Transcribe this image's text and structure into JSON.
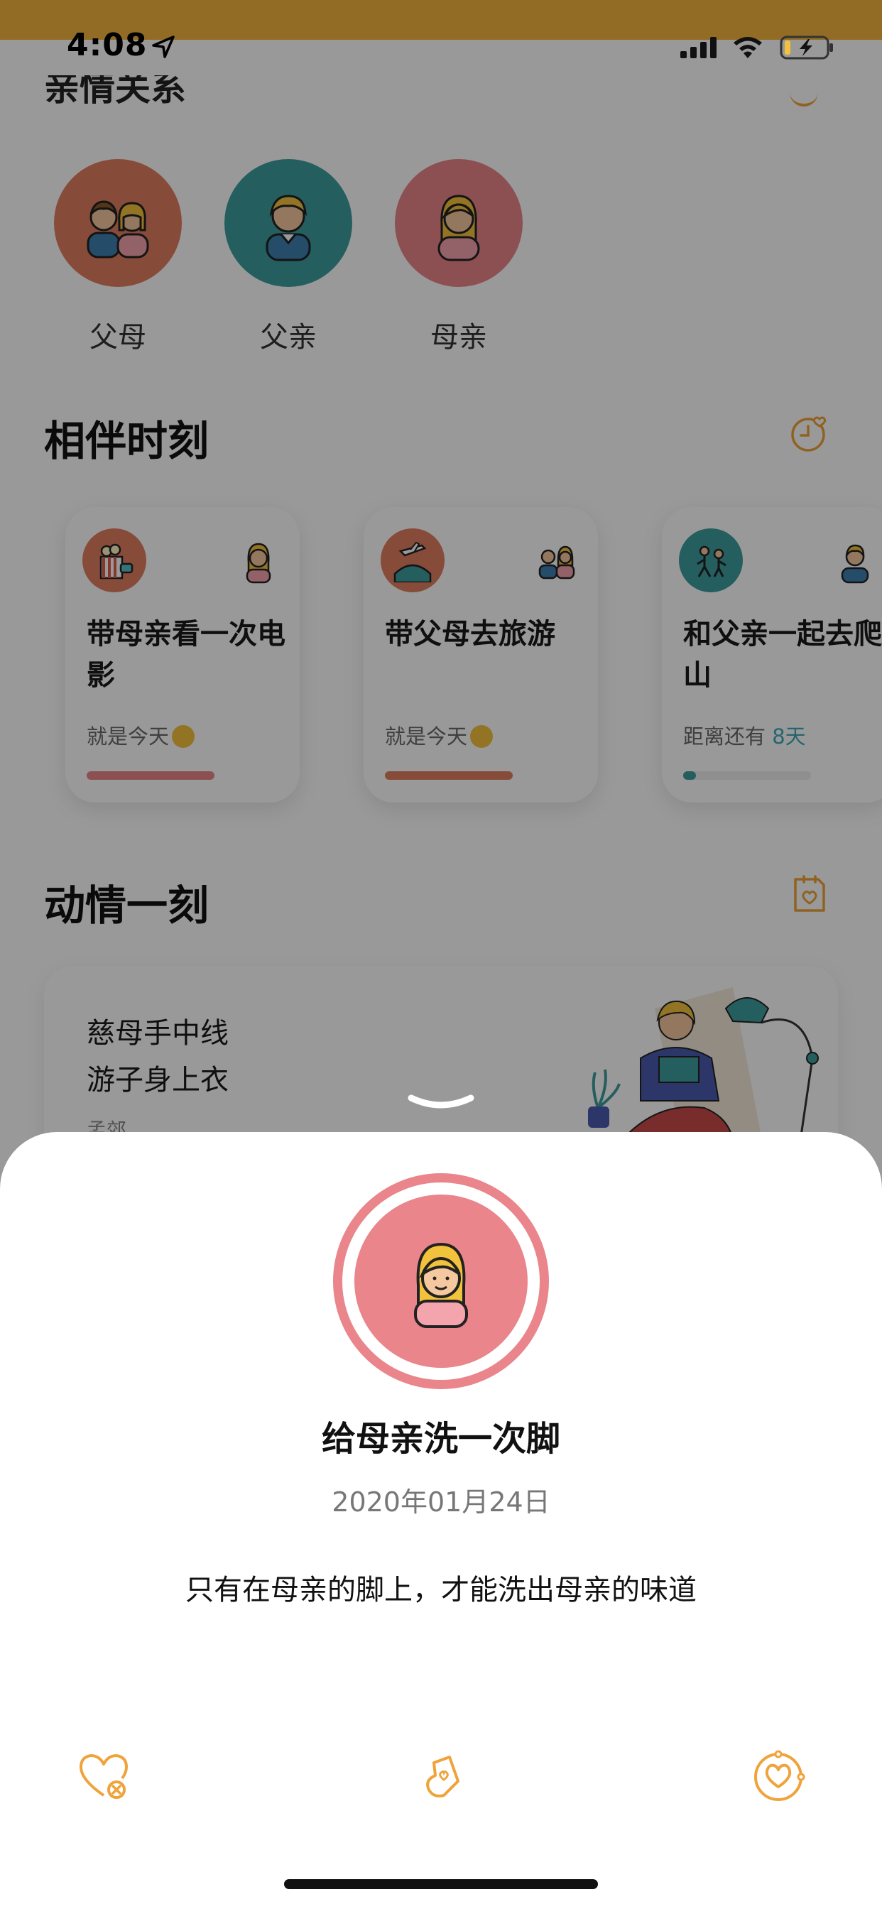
{
  "status_bar": {
    "time": "4:08",
    "icons": [
      "location-arrow-icon",
      "cellular-signal-icon",
      "wifi-icon",
      "battery-charging-icon"
    ]
  },
  "family": {
    "members": [
      {
        "label": "父母",
        "color": "#e27d61",
        "icon": "parents-avatar-icon"
      },
      {
        "label": "父亲",
        "color": "#3e9d9e",
        "icon": "father-avatar-icon"
      },
      {
        "label": "母亲",
        "color": "#e9858b",
        "icon": "mother-avatar-icon"
      }
    ]
  },
  "moments_section": {
    "title": "相伴时刻",
    "icon": "clock-heart-icon",
    "cards": [
      {
        "title": "带母亲看一次电影",
        "status": "就是今天",
        "icon": "movie-icon",
        "icon_color": "#e27d61",
        "person_icon": "mother-avatar-icon",
        "bar_color": "#e9858b"
      },
      {
        "title": "带父母去旅游",
        "status": "就是今天",
        "icon": "travel-icon",
        "icon_color": "#e27d61",
        "person_icon": "parents-avatar-icon",
        "bar_color": "#e27d61"
      },
      {
        "title": "和父亲一起去爬山",
        "status": "距离还有",
        "days": "8天",
        "icon": "hiking-icon",
        "icon_color": "#3e9d9e",
        "person_icon": "father-avatar-icon",
        "bar_color": "#3e9d9e"
      }
    ]
  },
  "touching_section": {
    "title": "动情一刻",
    "icon": "heart-note-icon",
    "poem_lines": [
      "慈母手中线",
      "游子身上衣"
    ],
    "author": "孟郊"
  },
  "sheet": {
    "avatar_icon": "mother-avatar-icon",
    "avatar_color": "#e9858b",
    "title": "给母亲洗一次脚",
    "date": "2020年01月24日",
    "description": "只有在母亲的脚上，才能洗出母亲的味道",
    "accent_color": "#f0a33a",
    "actions": [
      "heart-remove-icon",
      "share-heart-icon",
      "heart-circle-icon"
    ]
  }
}
